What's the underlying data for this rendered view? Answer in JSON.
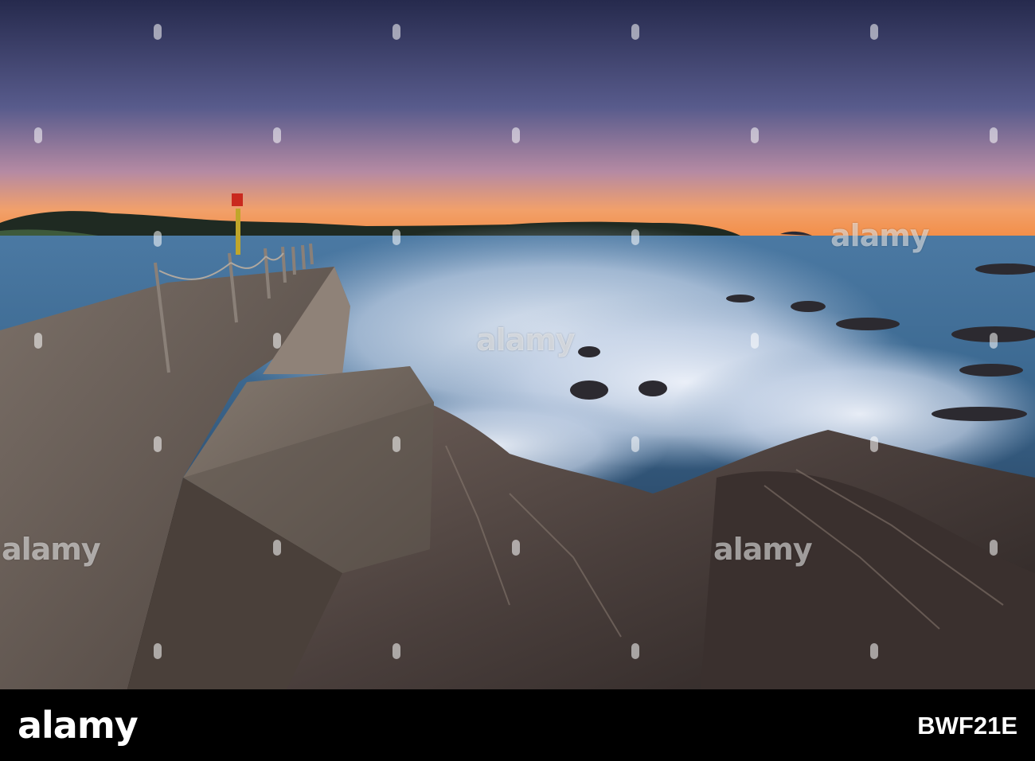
{
  "watermark": {
    "text": "alamy"
  },
  "footer": {
    "logo": "alamy",
    "image_id": "BWF21E"
  },
  "colors": {
    "sky_top": "#2c2f55",
    "sky_horizon": "#f39a55",
    "sea": "#3f6f98",
    "foam": "#dfe6f2",
    "rock": "#4a3f3c",
    "pier": "#6a5f58",
    "marker": "#c92a1e"
  }
}
